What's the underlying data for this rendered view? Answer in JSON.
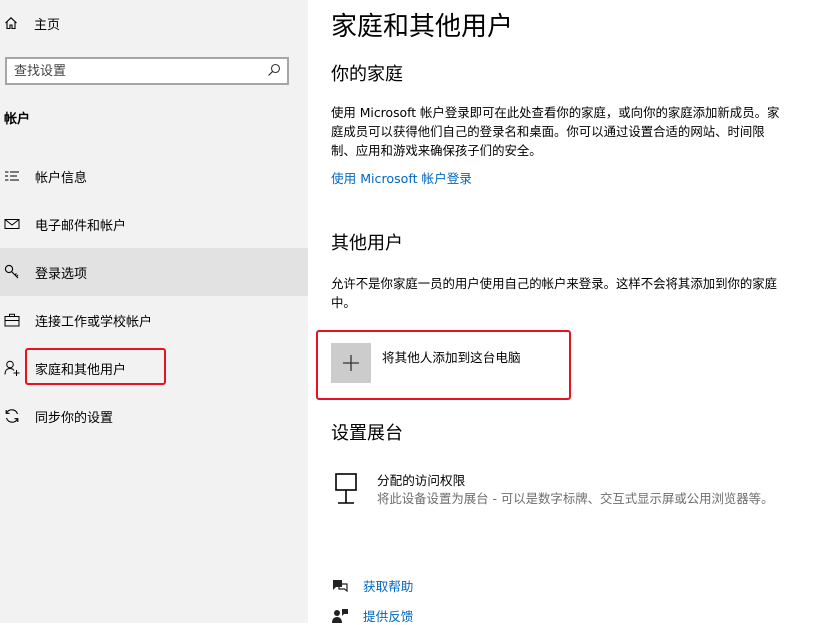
{
  "sidebar": {
    "home": {
      "label": "主页",
      "icon": "home-icon"
    },
    "search": {
      "placeholder": "查找设置",
      "icon": "search-icon"
    },
    "section_title": "帐户",
    "items": [
      {
        "label": "帐户信息",
        "icon": "account-info-icon"
      },
      {
        "label": "电子邮件和帐户",
        "icon": "mail-icon"
      },
      {
        "label": "登录选项",
        "icon": "key-icon",
        "active": true
      },
      {
        "label": "连接工作或学校帐户",
        "icon": "briefcase-icon"
      },
      {
        "label": "家庭和其他用户",
        "icon": "add-person-icon",
        "highlighted": true
      },
      {
        "label": "同步你的设置",
        "icon": "sync-icon"
      }
    ]
  },
  "main": {
    "title": "家庭和其他用户",
    "family": {
      "heading": "你的家庭",
      "description": "使用 Microsoft 帐户登录即可在此处查看你的家庭，或向你的家庭添加新成员。家庭成员可以获得他们自己的登录名和桌面。你可以通过设置合适的网站、时间限制、应用和游戏来确保孩子们的安全。",
      "link": "使用 Microsoft 帐户登录"
    },
    "other_users": {
      "heading": "其他用户",
      "description": "允许不是你家庭一员的用户使用自己的帐户来登录。这样不会将其添加到你的家庭中。",
      "add_label": "将其他人添加到这台电脑"
    },
    "kiosk": {
      "heading": "设置展台",
      "title": "分配的访问权限",
      "description": "将此设备设置为展台 - 可以是数字标牌、交互式显示屏或公用浏览器等。"
    },
    "help": {
      "get_help": "获取帮助",
      "feedback": "提供反馈"
    }
  },
  "colors": {
    "accent": "#0067c0",
    "highlight_border": "#e81123",
    "sidebar_bg": "#f2f2f2"
  }
}
